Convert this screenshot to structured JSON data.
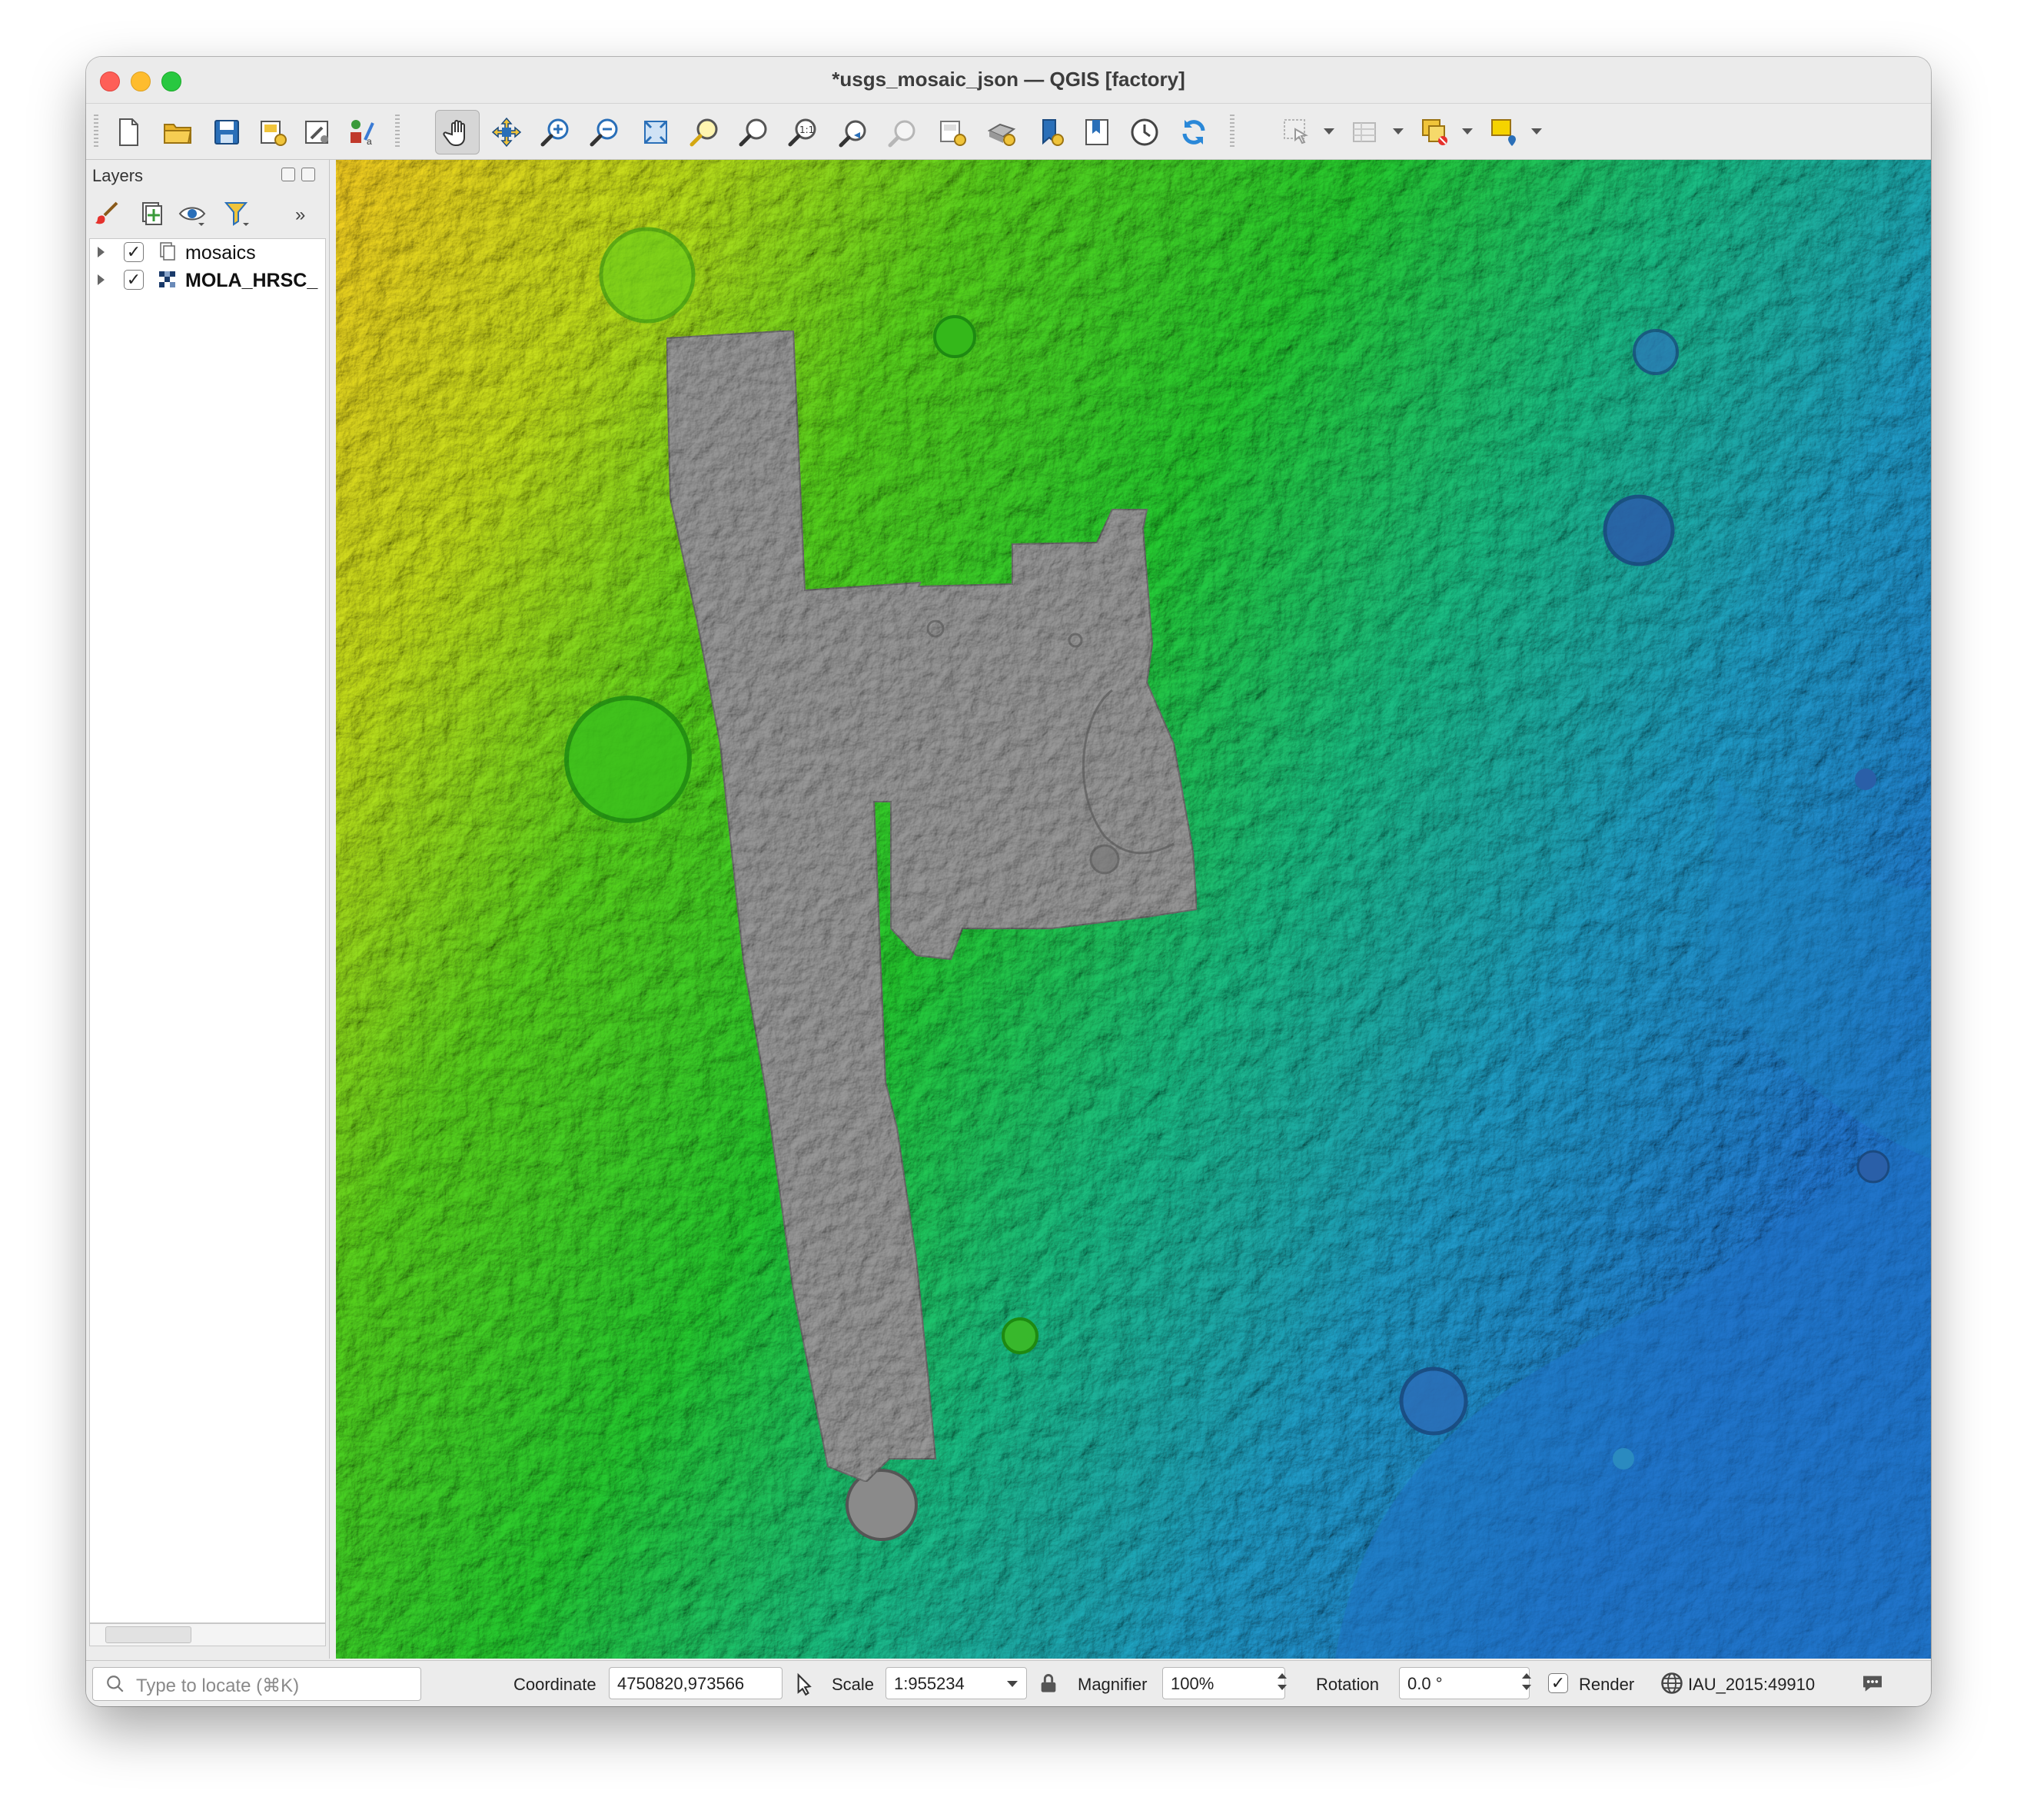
{
  "window": {
    "title": "*usgs_mosaic_json — QGIS [factory]"
  },
  "toolbar": {
    "buttons": [
      "new-project",
      "open-project",
      "save-project",
      "new-print-layout",
      "layout-manager",
      "style-manager",
      "pan",
      "pan-to-selection",
      "zoom-in",
      "zoom-out",
      "zoom-full",
      "zoom-to-selection",
      "zoom-to-layer",
      "zoom-native",
      "zoom-last",
      "zoom-next",
      "new-map-view",
      "new-3d-map-view",
      "new-bookmark",
      "show-bookmarks",
      "temporal-controller",
      "refresh",
      "select-features",
      "attribute-table",
      "deselect",
      "add-annotation"
    ]
  },
  "layers_panel": {
    "title": "Layers",
    "layers": [
      {
        "name": "mosaics",
        "checked": true,
        "icon": "group-icon"
      },
      {
        "name": "MOLA_HRSC_",
        "checked": true,
        "icon": "raster-icon"
      }
    ]
  },
  "statusbar": {
    "locate_placeholder": "Type to locate (⌘K)",
    "coordinate_label": "Coordinate",
    "coordinate_value": "4750820,973566",
    "scale_label": "Scale",
    "scale_value": "1:955234",
    "magnifier_label": "Magnifier",
    "magnifier_value": "100%",
    "rotation_label": "Rotation",
    "rotation_value": "0.0 °",
    "render_label": "Render",
    "render_checked": true,
    "crs_value": "IAU_2015:49910"
  },
  "colors": {
    "terrain_high": "#e8c41c",
    "terrain_mid": "#2fc21c",
    "terrain_low": "#1f7fc4",
    "mosaic_gray": "#8e8e8e"
  }
}
